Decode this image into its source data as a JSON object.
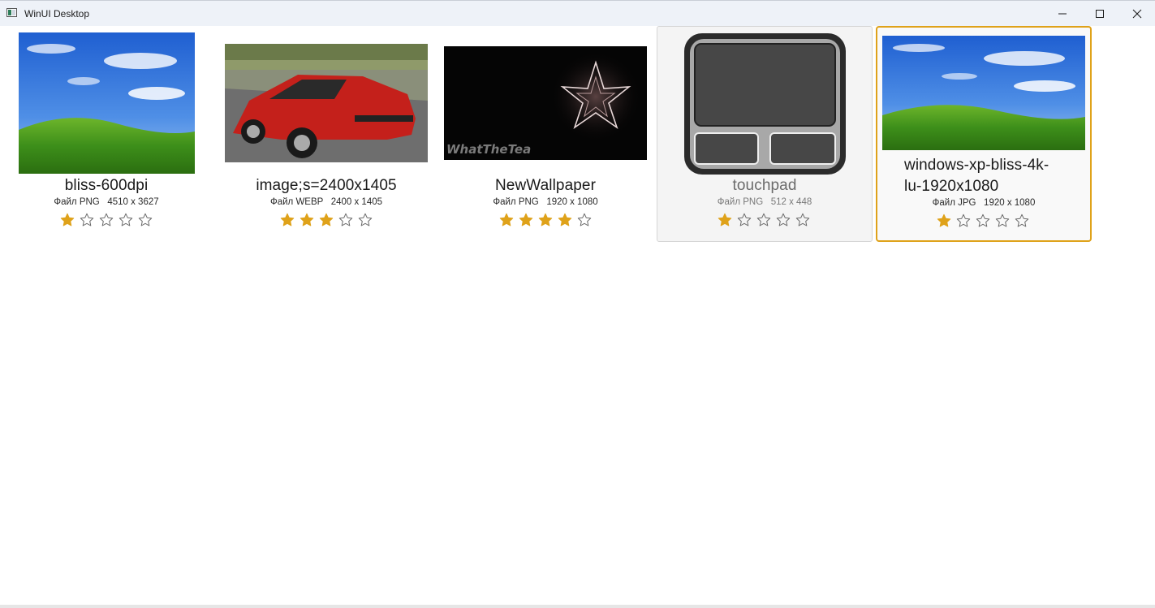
{
  "window": {
    "title": "WinUI Desktop",
    "minimize_icon": "minimize-icon",
    "maximize_icon": "maximize-icon",
    "close_icon": "close-icon"
  },
  "colors": {
    "accent": "#dfa21a",
    "star_filled": "#dfa21a",
    "star_empty_outline": "#6a6a6a",
    "titlebar_bg": "#eef2f8"
  },
  "photos": [
    {
      "name": "bliss-600dpi",
      "meta": "Файл PNG   4510 x 3627",
      "rating": 1,
      "max_rating": 5,
      "state": "normal",
      "thumbnail_icon": "landscape-thumbnail"
    },
    {
      "name": "image;s=2400x1405",
      "meta": "Файл WEBP   2400 x 1405",
      "rating": 3,
      "max_rating": 5,
      "state": "normal",
      "thumbnail_icon": "red-car-thumbnail"
    },
    {
      "name": "NewWallpaper",
      "meta": "Файл PNG   1920 x 1080",
      "rating": 4,
      "max_rating": 5,
      "state": "normal",
      "thumbnail_icon": "dark-logo-thumbnail",
      "thumbnail_text": "WhatTheTea"
    },
    {
      "name": "touchpad",
      "meta": "Файл PNG   512 x 448",
      "rating": 1,
      "max_rating": 5,
      "state": "hover",
      "thumbnail_icon": "touchpad-icon"
    },
    {
      "name": "windows-xp-bliss-4k-lu-1920x1080",
      "name_line1": "windows-xp-bliss-4k-",
      "name_line2": "lu-1920x1080",
      "meta": "Файл JPG   1920 x 1080",
      "rating": 1,
      "max_rating": 5,
      "state": "selected",
      "thumbnail_icon": "landscape-thumbnail"
    }
  ]
}
